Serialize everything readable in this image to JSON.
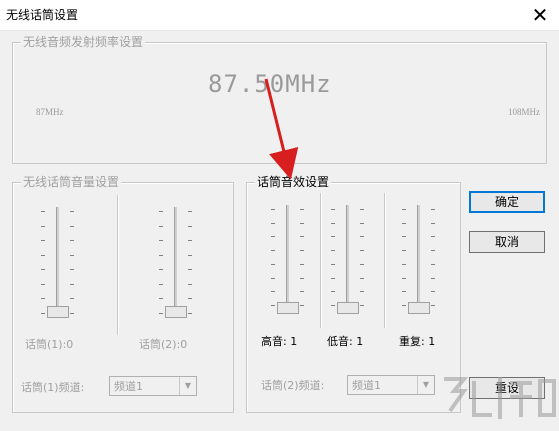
{
  "window": {
    "title": "无线话筒设置",
    "close_glyph": "✕"
  },
  "frequency_group": {
    "title": "无线音频发射频率设置",
    "value": "87.50MHz",
    "min_label": "87MHz",
    "max_label": "108MHz",
    "enabled": false
  },
  "volume_group": {
    "title": "无线话筒音量设置",
    "enabled": false,
    "mic1_label": "话筒(1):0",
    "mic2_label": "话筒(2):0",
    "mic1_channel_label": "话筒(1)频道:",
    "mic1_channel_value": "频道1",
    "mic1_level": 0,
    "mic2_level": 0
  },
  "effects_group": {
    "title": "话筒音效设置",
    "enabled": true,
    "treble_label": "高音: 1",
    "bass_label": "低音: 1",
    "repeat_label": "重复: 1",
    "mic2_channel_label": "话筒(2)频道:",
    "mic2_channel_value": "频道1",
    "treble_level": 1,
    "bass_level": 1,
    "repeat_level": 1
  },
  "buttons": {
    "ok": "确定",
    "cancel": "取消",
    "reset": "重设"
  },
  "colors": {
    "annotation_arrow": "#d81e1e"
  },
  "watermark_icon": "site-logo-watermark"
}
